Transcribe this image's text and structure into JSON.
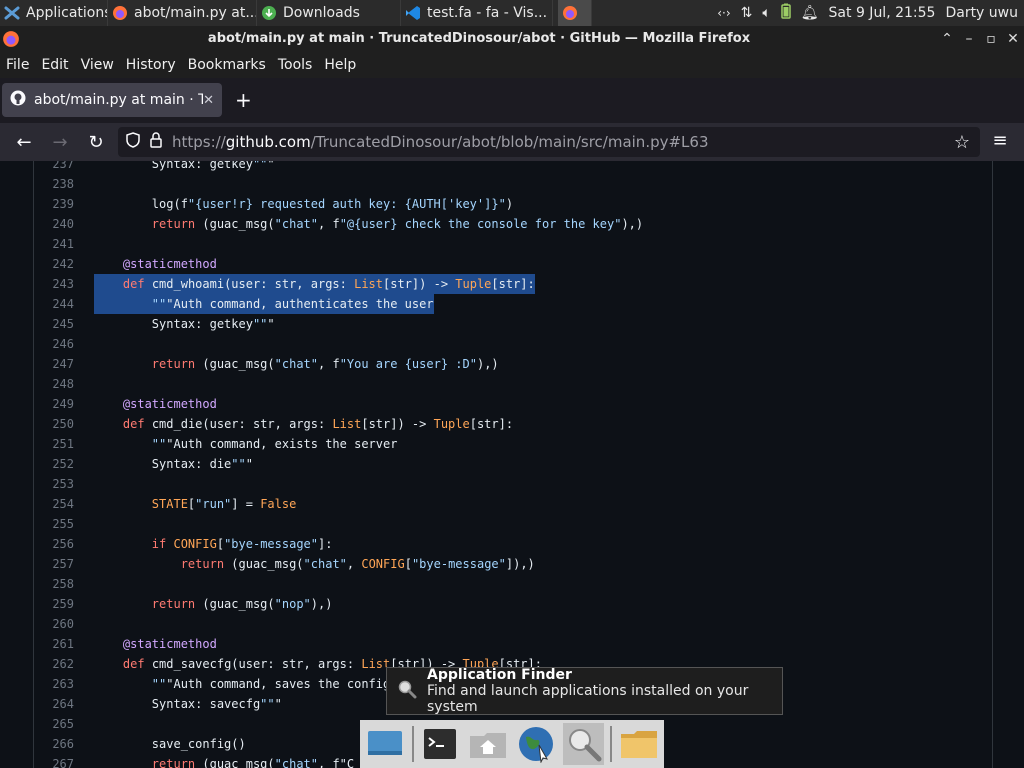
{
  "taskbar": {
    "applications_label": "Applications",
    "tasks": [
      {
        "label": "abot/main.py at..."
      },
      {
        "label": "Downloads"
      },
      {
        "label": "test.fa - fa - Vis..."
      }
    ],
    "clock": "Sat  9 Jul, 21:55",
    "user": "Darty uwu"
  },
  "window": {
    "title": "abot/main.py at main · TruncatedDinosour/abot · GitHub — Mozilla Firefox"
  },
  "menu": [
    "File",
    "Edit",
    "View",
    "History",
    "Bookmarks",
    "Tools",
    "Help"
  ],
  "tab": {
    "title": "abot/main.py at main · Tr"
  },
  "url": {
    "prefix": "https://",
    "domain": "github.com",
    "path": "/TruncatedDinosour/abot/blob/main/src/main.py#L63"
  },
  "code_lines": [
    {
      "n": "237",
      "text": "        Syntax: getkey\"\"\""
    },
    {
      "n": "238",
      "text": ""
    },
    {
      "n": "239",
      "text": "        log(f\"{user!r} requested auth key: {AUTH['key']}\")"
    },
    {
      "n": "240",
      "text": "        return (guac_msg(\"chat\", f\"@{user} check the console for the key\"),)"
    },
    {
      "n": "241",
      "text": ""
    },
    {
      "n": "242",
      "text": "    @staticmethod"
    },
    {
      "n": "243",
      "text": "    def cmd_whoami(user: str, args: List[str]) -> Tuple[str]:"
    },
    {
      "n": "244",
      "text": "        \"\"\"Auth command, authenticates the user"
    },
    {
      "n": "245",
      "text": "        Syntax: getkey\"\"\""
    },
    {
      "n": "246",
      "text": ""
    },
    {
      "n": "247",
      "text": "        return (guac_msg(\"chat\", f\"You are {user} :D\"),)"
    },
    {
      "n": "248",
      "text": ""
    },
    {
      "n": "249",
      "text": "    @staticmethod"
    },
    {
      "n": "250",
      "text": "    def cmd_die(user: str, args: List[str]) -> Tuple[str]:"
    },
    {
      "n": "251",
      "text": "        \"\"\"Auth command, exists the server"
    },
    {
      "n": "252",
      "text": "        Syntax: die\"\"\""
    },
    {
      "n": "253",
      "text": ""
    },
    {
      "n": "254",
      "text": "        STATE[\"run\"] = False"
    },
    {
      "n": "255",
      "text": ""
    },
    {
      "n": "256",
      "text": "        if CONFIG[\"bye-message\"]:"
    },
    {
      "n": "257",
      "text": "            return (guac_msg(\"chat\", CONFIG[\"bye-message\"]),)"
    },
    {
      "n": "258",
      "text": ""
    },
    {
      "n": "259",
      "text": "        return (guac_msg(\"nop\"),)"
    },
    {
      "n": "260",
      "text": ""
    },
    {
      "n": "261",
      "text": "    @staticmethod"
    },
    {
      "n": "262",
      "text": "    def cmd_savecfg(user: str, args: List[str]) -> Tuple[str]:"
    },
    {
      "n": "263",
      "text": "        \"\"\"Auth command, saves the config"
    },
    {
      "n": "264",
      "text": "        Syntax: savecfg\"\"\""
    },
    {
      "n": "265",
      "text": ""
    },
    {
      "n": "266",
      "text": "        save_config()"
    },
    {
      "n": "267",
      "text": "        return (guac_msg(\"chat\", f\"C"
    }
  ],
  "tooltip": {
    "title": "Application Finder",
    "description": "Find and launch applications installed on your system"
  },
  "dock": [
    "show-desktop-icon",
    "terminal-icon",
    "home-folder-icon",
    "web-browser-icon",
    "app-finder-icon",
    "files-icon"
  ],
  "colors": {
    "page_bg": "#0d1117",
    "keyword": "#ff7b72",
    "string": "#a5d6ff",
    "decorator": "#d2a8ff",
    "selection": "#1f4b8e"
  }
}
